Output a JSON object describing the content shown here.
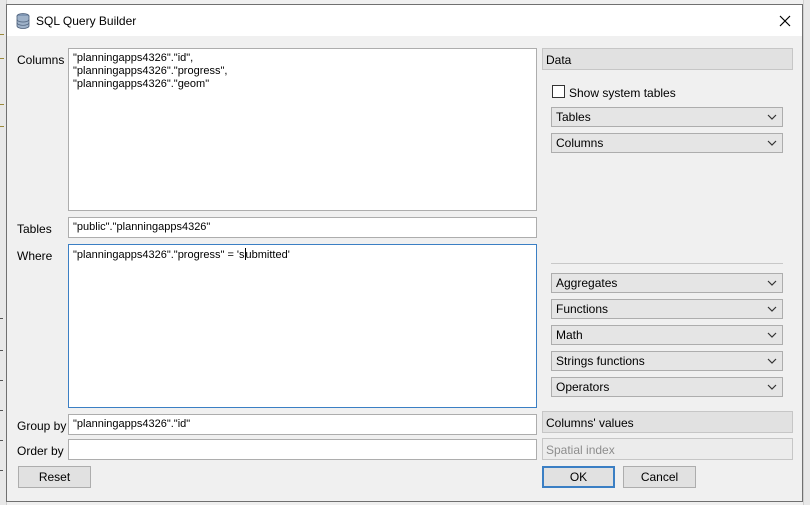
{
  "window": {
    "title": "SQL Query Builder"
  },
  "form": {
    "columns_label": "Columns",
    "columns_value": "\"planningapps4326\".\"id\",\n\"planningapps4326\".\"progress\",\n\"planningapps4326\".\"geom\"",
    "tables_label": "Tables",
    "tables_value": "\"public\".\"planningapps4326\"",
    "where_label": "Where",
    "where_value_before_caret": "\"planningapps4326\".\"progress\" = 's",
    "where_value_after_caret": "ubmitted'",
    "groupby_label": "Group by",
    "groupby_value": "\"planningapps4326\".\"id\"",
    "orderby_label": "Order by",
    "orderby_value": ""
  },
  "right_panel": {
    "data_label": "Data",
    "show_system_tables_label": "Show system tables",
    "show_system_tables_checked": false,
    "tables_combo": "Tables",
    "columns_combo": "Columns",
    "aggregates_combo": "Aggregates",
    "functions_combo": "Functions",
    "math_combo": "Math",
    "strings_combo": "Strings functions",
    "operators_combo": "Operators",
    "columns_values_label": "Columns' values",
    "spatial_index_label": "Spatial index"
  },
  "buttons": {
    "reset": "Reset",
    "ok": "OK",
    "cancel": "Cancel"
  },
  "icons": {
    "title": "database-icon",
    "close": "close-icon",
    "dropdown": "chevron-down-icon"
  }
}
